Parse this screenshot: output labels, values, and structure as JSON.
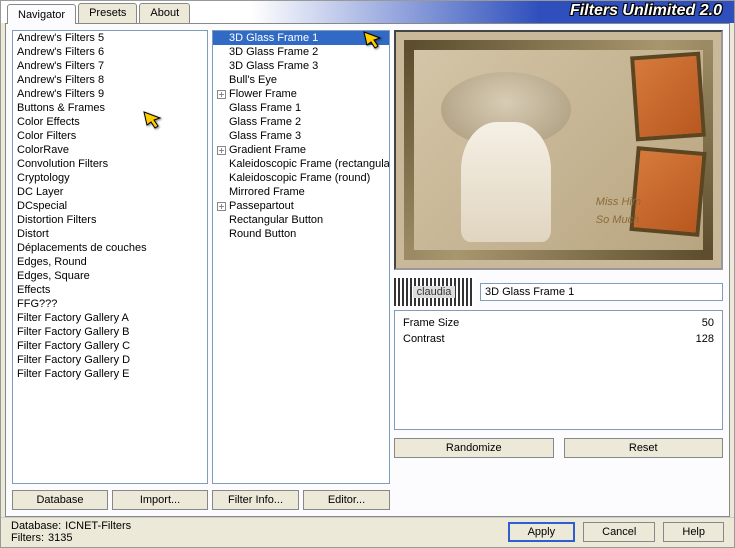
{
  "app_title": "Filters Unlimited 2.0",
  "tabs": [
    {
      "label": "Navigator",
      "active": true
    },
    {
      "label": "Presets",
      "active": false
    },
    {
      "label": "About",
      "active": false
    }
  ],
  "categories": [
    "Andrew's Filters 5",
    "Andrew's Filters 6",
    "Andrew's Filters 7",
    "Andrew's Filters 8",
    "Andrew's Filters 9",
    "Buttons & Frames",
    "Color Effects",
    "Color Filters",
    "ColorRave",
    "Convolution Filters",
    "Cryptology",
    "DC Layer",
    "DCspecial",
    "Distortion Filters",
    "Distort",
    "Déplacements de couches",
    "Edges, Round",
    "Edges, Square",
    "Effects",
    "FFG???",
    "Filter Factory Gallery A",
    "Filter Factory Gallery B",
    "Filter Factory Gallery C",
    "Filter Factory Gallery D",
    "Filter Factory Gallery E"
  ],
  "category_selected_index": 5,
  "filters": [
    {
      "label": "3D Glass Frame 1",
      "tree": "none",
      "selected": true
    },
    {
      "label": "3D Glass Frame 2",
      "tree": "none"
    },
    {
      "label": "3D Glass Frame 3",
      "tree": "none"
    },
    {
      "label": "Bull's Eye",
      "tree": "none"
    },
    {
      "label": "Flower Frame",
      "tree": "plus"
    },
    {
      "label": "Glass Frame 1",
      "tree": "none"
    },
    {
      "label": "Glass Frame 2",
      "tree": "none"
    },
    {
      "label": "Glass Frame 3",
      "tree": "none"
    },
    {
      "label": "Gradient Frame",
      "tree": "plus"
    },
    {
      "label": "Kaleidoscopic Frame (rectangular)",
      "tree": "none"
    },
    {
      "label": "Kaleidoscopic Frame (round)",
      "tree": "none"
    },
    {
      "label": "Mirrored Frame",
      "tree": "none"
    },
    {
      "label": "Passepartout",
      "tree": "plus"
    },
    {
      "label": "Rectangular Button",
      "tree": "none"
    },
    {
      "label": "Round Button",
      "tree": "none"
    }
  ],
  "left_buttons": {
    "database": "Database",
    "import": "Import..."
  },
  "mid_buttons": {
    "info": "Filter Info...",
    "editor": "Editor..."
  },
  "right_buttons": {
    "randomize": "Randomize",
    "reset": "Reset"
  },
  "current_filter_name": "3D Glass Frame 1",
  "watermark_text": "claudia",
  "preview_text_1": "Miss Him",
  "preview_text_2": "So Much",
  "sliders": [
    {
      "name": "Frame Size",
      "value": 50
    },
    {
      "name": "Contrast",
      "value": 128
    }
  ],
  "footer": {
    "db_label": "Database:",
    "db_value": "ICNET-Filters",
    "filters_label": "Filters:",
    "filters_value": "3135",
    "apply": "Apply",
    "cancel": "Cancel",
    "help": "Help"
  }
}
